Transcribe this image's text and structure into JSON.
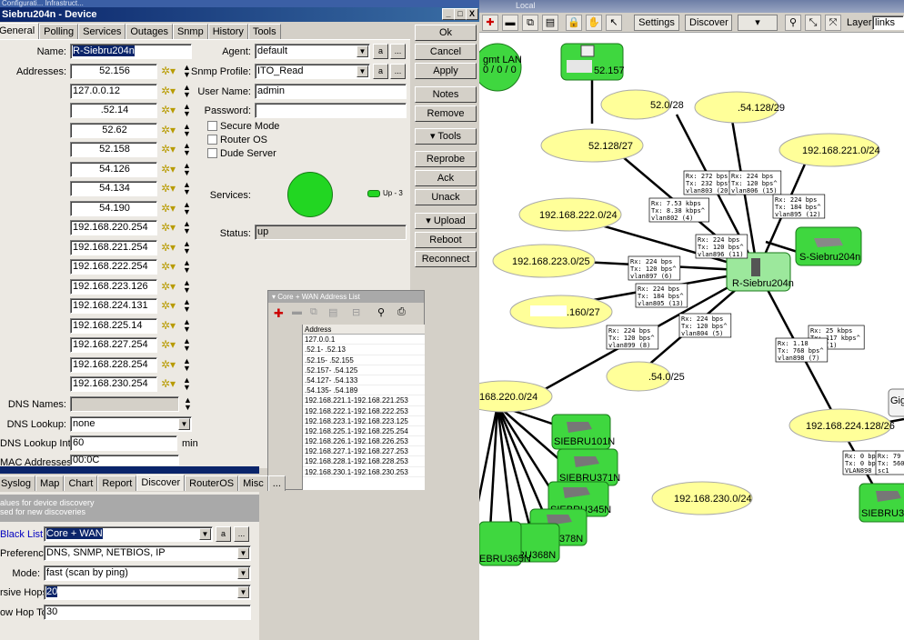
{
  "window": {
    "top_strip_text": "Configurati...   Infrastruct...",
    "title": "Siebru204n - Device",
    "close": "X"
  },
  "tabs": [
    "General",
    "Polling",
    "Services",
    "Outages",
    "Snmp",
    "History",
    "Tools"
  ],
  "general": {
    "name_label": "Name:",
    "name_value": "R-Siebru204n",
    "addresses_label": "Addresses:",
    "addresses": [
      "52.156",
      "127.0.0.12",
      ".52.14",
      "52.62",
      "52.158",
      "54.126",
      "54.134",
      "54.190",
      "192.168.220.254",
      "192.168.221.254",
      "192.168.222.254",
      "192.168.223.126",
      "192.168.224.131",
      "192.168.225.14",
      "192.168.227.254",
      "192.168.228.254",
      "192.168.230.254"
    ],
    "dns_names_label": "DNS Names:",
    "dns_lookup_label": "DNS Lookup:",
    "dns_lookup_value": "none",
    "dns_interval_label": "DNS Lookup Interval:",
    "dns_interval_value": "60",
    "dns_interval_unit": "min",
    "mac_label": "MAC Addresses:",
    "mac_value": "00:0C",
    "agent_label": "Agent:",
    "agent_value": "default",
    "snmp_label": "Snmp Profile:",
    "snmp_value": "ITO_Read",
    "user_label": "User Name:",
    "user_value": "admin",
    "password_label": "Password:",
    "password_value": "",
    "checkboxes": [
      "Secure Mode",
      "Router OS",
      "Dude Server"
    ],
    "services_label": "Services:",
    "services_legend": "Up - 3",
    "status_label": "Status:",
    "status_value": "up",
    "dots_button": "...",
    "small_button": "a"
  },
  "side_buttons": [
    "Ok",
    "Cancel",
    "Apply",
    "Notes",
    "Remove",
    "▾ Tools",
    "Reprobe",
    "Ack",
    "Unack",
    "▾ Upload",
    "Reboot",
    "Reconnect"
  ],
  "address_list": {
    "title": "Core + WAN Address List",
    "header": "Address",
    "rows": [
      "127.0.0.1",
      ".52.1-        .52.13",
      ".52.15-        .52.155",
      ".52.157-       .54.125",
      ".54.127-       .54.133",
      ".54.135-       .54.189",
      "192.168.221.1-192.168.221.253",
      "192.168.222.1-192.168.222.253",
      "192.168.223.1-192.168.223.125",
      "192.168.225.1-192.168.225.254",
      "192.168.226.1-192.168.226.253",
      "192.168.227.1-192.168.227.253",
      "192.168.228.1-192.168.228.253",
      "192.168.230.1-192.168.230.253"
    ]
  },
  "discover": {
    "tabs": [
      "Syslog",
      "Map",
      "Chart",
      "Report",
      "Discover",
      "RouterOS",
      "Misc",
      "..."
    ],
    "header_line1": "alues for device discovery",
    "header_line2": "sed for new discoveries",
    "black_list_label": "Black List:",
    "black_list_value": "Core + WAN",
    "preference_label": "Preference:",
    "preference_value": "DNS, SNMP, NETBIOS, IP",
    "mode_label": "Mode:",
    "mode_value": "fast (scan by ping)",
    "hops_label": "rsive Hops:",
    "hops_value": "20",
    "hop_to_label": "ow Hop To:",
    "hop_to_value": "30"
  },
  "map": {
    "title": "Local",
    "toolbar": {
      "settings": "Settings",
      "discover": "Discover",
      "tools": "▾ Tools",
      "layer_label": "Layer:",
      "layer_value": "links"
    },
    "clouds": [
      "52.0/28",
      ".54.128/29",
      "52.128/27",
      "192.168.221.0/24",
      "192.168.222.0/24",
      "192.168.223.0/25",
      ".160/27",
      ".54.0/25",
      "168.220.0/24",
      "192.168.224.128/26",
      "192.168.230.0/24"
    ],
    "devices": [
      "52.157",
      "R-Siebru204n",
      "S-Siebru204n",
      "SIEBRU101N",
      "SIEBRU371N",
      "SIEBRU345N",
      "U378N",
      "RU368N",
      "EBRU365N",
      "SIEBRU31",
      "Gig"
    ],
    "mgmt_label": "gmt LAN",
    "mgmt_sub": "0 / 0 / 0",
    "link_labels": [
      "Rx: 272 bps\nTx: 232 bps^\nvlan803 (20)",
      "Rx: 224 bps\nTx: 120 bps^\nvlan806 (15)",
      "Rx: 7.53 kbps\nTx: 8.38 kbps^\nvlan802 (4)",
      "Rx: 224 bps\nTx: 184 bps^\nvlan895 (12)",
      "Rx: 224 bps\nTx: 120 bps^\nvlan896 (11)",
      "Rx: 224 bps\nTx: 120 bps^\nvlan897 (6)",
      "Rx: 224 bps\nTx: 184 bps^\nvlan805 (13)",
      "Rx: 224 bps\nTx: 120 bps^\nvlan899 (8)",
      "Rx: 224 bps\nTx: 120 bps^\nvlan804 (5)",
      "Rx: 25 kbps\nTx: 117 kbps^\nsc0 (1)",
      "Rx: 1.18\nTx: 768 bps^\nvlan898 (7)",
      "Rx: 0 bp\nTx: 0 bp\nVLAN898",
      "Rx: 79\nTx: 560\nsc1"
    ]
  }
}
